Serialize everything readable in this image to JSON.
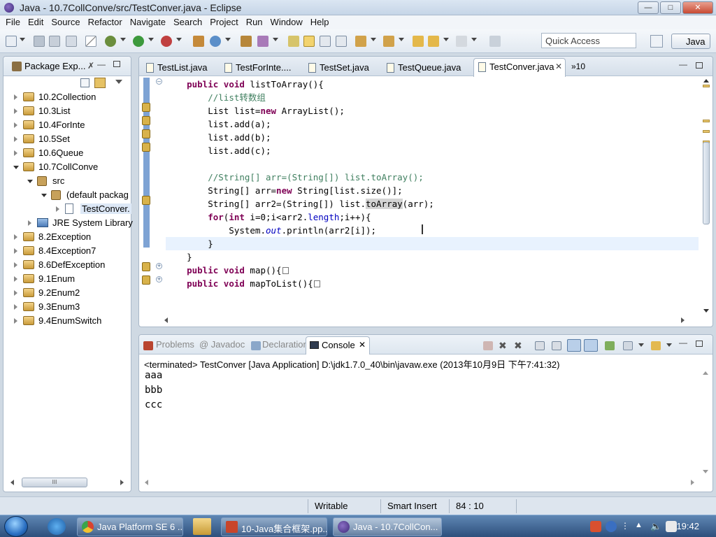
{
  "window": {
    "title": "Java - 10.7CollConve/src/TestConver.java - Eclipse",
    "min_symbol": "—",
    "max_symbol": "□",
    "close_symbol": "✕"
  },
  "menu": [
    "File",
    "Edit",
    "Source",
    "Refactor",
    "Navigate",
    "Search",
    "Project",
    "Run",
    "Window",
    "Help"
  ],
  "toolbar": {
    "quick_access_placeholder": "Quick Access",
    "perspective_label": "Java"
  },
  "package_explorer": {
    "title": "Package Exp...",
    "tree": [
      {
        "label": "10.2Collection",
        "type": "project",
        "expanded": false,
        "indent": 0
      },
      {
        "label": "10.3List",
        "type": "project",
        "expanded": false,
        "indent": 0
      },
      {
        "label": "10.4ForInte",
        "type": "project",
        "expanded": false,
        "indent": 0
      },
      {
        "label": "10.5Set",
        "type": "project",
        "expanded": false,
        "indent": 0
      },
      {
        "label": "10.6Queue",
        "type": "project",
        "expanded": false,
        "indent": 0
      },
      {
        "label": "10.7CollConve",
        "type": "project",
        "expanded": true,
        "indent": 0
      },
      {
        "label": "src",
        "type": "source-folder",
        "expanded": true,
        "indent": 1
      },
      {
        "label": "(default packag",
        "type": "package",
        "expanded": true,
        "indent": 2
      },
      {
        "label": "TestConver.",
        "type": "java-file",
        "expanded": false,
        "indent": 3
      },
      {
        "label": "JRE System Library",
        "type": "library",
        "expanded": false,
        "indent": 1
      },
      {
        "label": "8.2Exception",
        "type": "project",
        "expanded": false,
        "indent": 0
      },
      {
        "label": "8.4Exception7",
        "type": "project",
        "expanded": false,
        "indent": 0
      },
      {
        "label": "8.6DefException",
        "type": "project",
        "expanded": false,
        "indent": 0
      },
      {
        "label": "9.1Enum",
        "type": "project",
        "expanded": false,
        "indent": 0
      },
      {
        "label": "9.2Enum2",
        "type": "project",
        "expanded": false,
        "indent": 0
      },
      {
        "label": "9.3Enum3",
        "type": "project",
        "expanded": false,
        "indent": 0
      },
      {
        "label": "9.4EnumSwitch",
        "type": "project",
        "expanded": false,
        "indent": 0
      }
    ],
    "hscroll_thumb_label": "III"
  },
  "editor": {
    "tabs": [
      {
        "label": "TestList.java",
        "active": false
      },
      {
        "label": "TestForInte....",
        "active": false
      },
      {
        "label": "TestSet.java",
        "active": false
      },
      {
        "label": "TestQueue.java",
        "active": false
      },
      {
        "label": "TestConver.java",
        "active": true
      }
    ],
    "overflow_label": "»10",
    "code_lines": [
      "    public void listToArray(){",
      "        //list转数组",
      "        List list=new ArrayList();",
      "        list.add(a);",
      "        list.add(b);",
      "        list.add(c);",
      "",
      "        //String[] arr=(String[]) list.toArray();",
      "        String[] arr=new String[list.size()];",
      "        String[] arr2=(String[]) list.toArray(arr);",
      "        for(int i=0;i<arr2.length;i++){",
      "            System.out.println(arr2[i]);",
      "        }",
      "    }",
      "    public void map(){",
      "    public void mapToList(){"
    ]
  },
  "console": {
    "tabs": [
      {
        "label": "Problems",
        "active": false
      },
      {
        "label": "@ Javadoc",
        "active": false
      },
      {
        "label": "Declaration",
        "active": false
      },
      {
        "label": "Console",
        "active": true
      }
    ],
    "status": "<terminated> TestConver [Java Application] D:\\jdk1.7.0_40\\bin\\javaw.exe (2013年10月9日 下午7:41:32)",
    "output": [
      "aaa",
      "bbb",
      "ccc"
    ]
  },
  "statusbar": {
    "writable": "Writable",
    "insert_mode": "Smart Insert",
    "position": "84 : 10"
  },
  "taskbar": {
    "buttons": [
      {
        "label": "Java Platform SE 6 ...",
        "active": false
      },
      {
        "label": "10-Java集合框架.pp...",
        "active": false
      },
      {
        "label": "Java - 10.7CollCon...",
        "active": true
      }
    ],
    "clock": "19:42"
  },
  "colors": {
    "keyword": "#7f0055",
    "comment": "#3f7f5f",
    "field": "#0000c0",
    "current_line": "#e8f2fe"
  }
}
